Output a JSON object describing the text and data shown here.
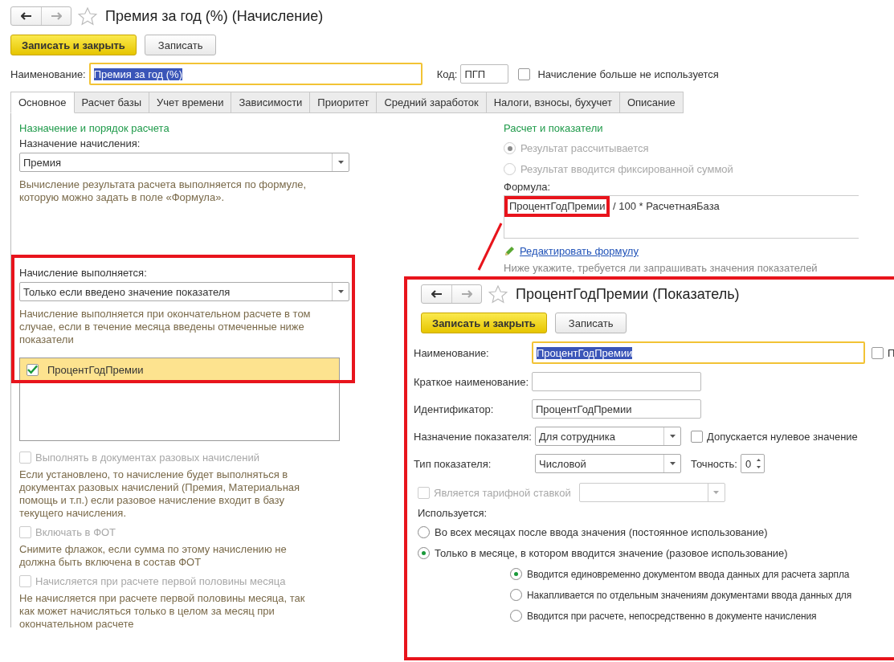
{
  "window": {
    "title": "Премия за год (%) (Начисление)"
  },
  "toolbar": {
    "buttons": [
      {
        "label": "Записать и закрыть",
        "kind": "primary"
      },
      {
        "label": "Записать",
        "kind": "default"
      }
    ]
  },
  "header": {
    "name_label": "Наименование:",
    "name_value": "Премия за год (%)",
    "code_label": "Код:",
    "code_value": "ПГП",
    "unused": {
      "label": "Начисление больше не используется",
      "checked": false
    }
  },
  "tabs": [
    {
      "label": "Основное",
      "selected": true
    },
    {
      "label": "Расчет базы",
      "selected": false
    },
    {
      "label": "Учет времени",
      "selected": false
    },
    {
      "label": "Зависимости",
      "selected": false
    },
    {
      "label": "Приоритет",
      "selected": false
    },
    {
      "label": "Средний заработок",
      "selected": false
    },
    {
      "label": "Налоги, взносы, бухучет",
      "selected": false
    },
    {
      "label": "Описание",
      "selected": false
    }
  ],
  "left": {
    "section_title": "Назначение и порядок расчета",
    "purpose_label": "Назначение начисления:",
    "purpose_value": "Премия",
    "purpose_hint": "Вычисление результата расчета выполняется по формуле, которую можно задать в поле «Формула».",
    "performed_label": "Начисление выполняется:",
    "performed_value": "Только если введено значение показателя",
    "performed_hint": "Начисление выполняется при окончательном расчете в том случае, если в течение месяца введены отмеченные ниже показатели",
    "indicators": [
      {
        "label": "ПроцентГодПремии",
        "checked": true,
        "selected": true
      }
    ],
    "options": [
      {
        "label": "Выполнять в документах разовых начислений",
        "checked": false,
        "disabled": true,
        "hint": "Если установлено, то начисление будет выполняться в документах разовых начислений (Премия, Материальная помощь и т.п.) если разовое начисление входит в базу текущего начисления."
      },
      {
        "label": "Включать в ФОТ",
        "checked": false,
        "disabled": true,
        "hint": "Снимите флажок, если сумма по этому начислению не должна быть включена в состав ФОТ"
      },
      {
        "label": "Начисляется при расчете первой половины месяца",
        "checked": false,
        "disabled": true,
        "hint": "Не начисляется при расчете первой половины месяца, так как может начисляться только в целом за месяц при окончательном расчете"
      }
    ]
  },
  "right": {
    "section_title": "Расчет и показатели",
    "result_modes": [
      {
        "label": "Результат рассчитывается",
        "selected": true,
        "disabled": true
      },
      {
        "label": "Результат вводится фиксированной суммой",
        "selected": false,
        "disabled": true
      }
    ],
    "formula_label": "Формула:",
    "formula_token": "ПроцентГодПремии",
    "formula_rest": "/ 100 * РасчетнаяБаза",
    "edit_link": "Редактировать формулу",
    "note": "Ниже укажите, требуется ли запрашивать значения показателей"
  },
  "popup": {
    "title": "ПроцентГодПремии (Показатель)",
    "buttons": [
      {
        "label": "Записать и закрыть",
        "kind": "primary"
      },
      {
        "label": "Записать",
        "kind": "default"
      }
    ],
    "name_label": "Наименование:",
    "name_value": "ПроцентГодПремии",
    "name_checkbox": {
      "label": "П",
      "checked": false
    },
    "short_label": "Краткое наименование:",
    "id_label": "Идентификатор:",
    "id_value": "ПроцентГодПремии",
    "purpose_label": "Назначение показателя:",
    "purpose_value": "Для сотрудника",
    "zero": {
      "label": "Допускается нулевое значение",
      "checked": false
    },
    "type_label": "Тип показателя:",
    "type_value": "Числовой",
    "precision_label": "Точность:",
    "precision_value": "0",
    "tariff": {
      "label": "Является тарифной ставкой",
      "checked": false,
      "disabled": true
    },
    "usage_label": "Используется:",
    "usage": [
      {
        "label": "Во всех месяцах после ввода значения (постоянное использование)",
        "selected": false
      },
      {
        "label": "Только в месяце, в котором вводится значение (разовое использование)",
        "selected": true,
        "children": [
          {
            "label": "Вводится единовременно документом ввода данных для расчета зарпла",
            "selected": true
          },
          {
            "label": "Накапливается по отдельным значениям документами ввода данных для",
            "selected": false
          },
          {
            "label": "Вводится при расчете, непосредственно в документе начисления",
            "selected": false
          }
        ]
      }
    ]
  }
}
